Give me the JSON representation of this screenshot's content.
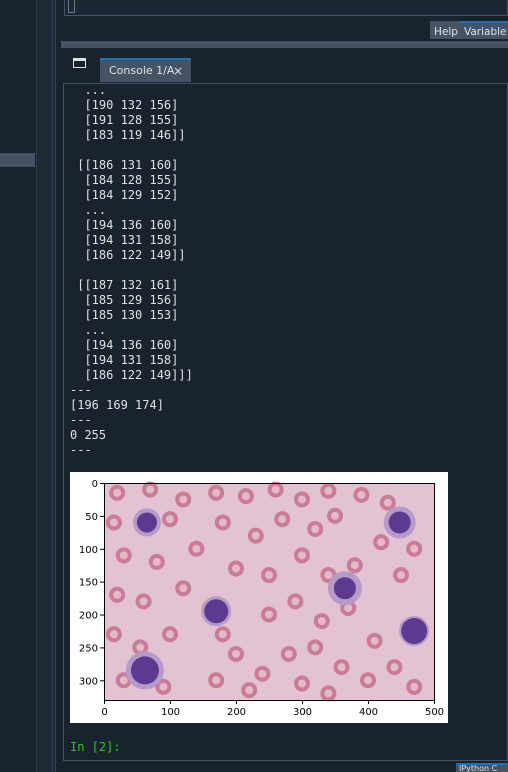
{
  "top_tabs": {
    "help": "Help",
    "variable_explorer": "Variable E"
  },
  "console_tab": {
    "label": "Console 1/A",
    "close": "×"
  },
  "console_output": [
    "  ...",
    "  [190 132 156]",
    "  [191 128 155]",
    "  [183 119 146]]",
    "",
    " [[186 131 160]",
    "  [184 128 155]",
    "  [184 129 152]",
    "  ...",
    "  [194 136 160]",
    "  [194 131 158]",
    "  [186 122 149]]",
    "",
    " [[187 132 161]",
    "  [185 129 156]",
    "  [185 130 153]",
    "  ...",
    "  [194 136 160]",
    "  [194 131 158]",
    "  [186 122 149]]]",
    "---",
    "[196 169 174]",
    "---",
    "0 255",
    "---"
  ],
  "plot": {
    "x_ticks": [
      "0",
      "100",
      "200",
      "300",
      "400",
      "500"
    ],
    "y_ticks": [
      "0",
      "50",
      "100",
      "150",
      "200",
      "250",
      "300"
    ],
    "xlim": [
      0,
      500
    ],
    "ylim": [
      0,
      330
    ],
    "colors": {
      "background": "#e2c2d3",
      "red_cell": "#c97c96",
      "red_cell_center": "#e6b9c9",
      "nucleus": "#5b3a8f",
      "cytoplasm": "#b79ac8"
    }
  },
  "prompt": "In [2]:",
  "status_tab": "IPython C"
}
